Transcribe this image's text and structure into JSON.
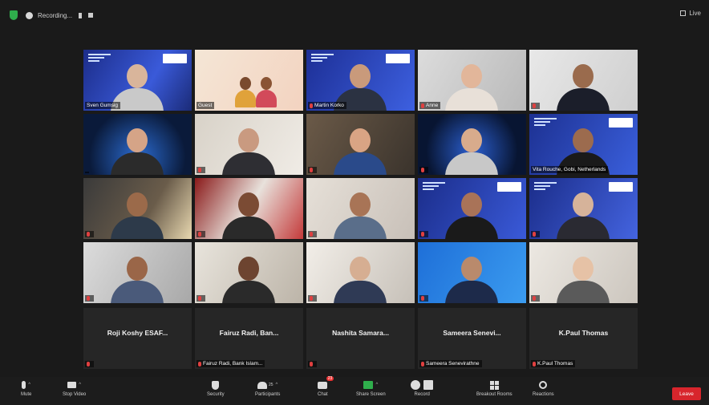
{
  "top_bar": {
    "recording_label": "Recording...",
    "view_label": "Live"
  },
  "colors": {
    "speaker_highlight": "#c9d43a",
    "leave": "#d8252c",
    "share_green": "#2fae4c",
    "muted_red": "#e04040"
  },
  "tiles": [
    {
      "name": "Sven Gumsig",
      "muted": false
    },
    {
      "name": "Guest",
      "muted": false
    },
    {
      "name": "Martin Korko",
      "muted": true
    },
    {
      "name": "Anne",
      "muted": true
    },
    {
      "name": "",
      "muted": true
    },
    {
      "name": "",
      "muted": false
    },
    {
      "name": "",
      "muted": true
    },
    {
      "name": "",
      "muted": true
    },
    {
      "name": "",
      "muted": true
    },
    {
      "name": "Vita Rouche, Gobi, Netherlands",
      "muted": false
    },
    {
      "name": "",
      "muted": true
    },
    {
      "name": "",
      "muted": true
    },
    {
      "name": "",
      "muted": true
    },
    {
      "name": "",
      "muted": true
    },
    {
      "name": "",
      "muted": true
    },
    {
      "name": "",
      "muted": true
    },
    {
      "name": "",
      "muted": true
    },
    {
      "name": "",
      "muted": true
    },
    {
      "name": "",
      "muted": true
    },
    {
      "name": "",
      "muted": true
    }
  ],
  "audio_only_tiles": [
    {
      "display": "Roji Koshy ESAF...",
      "label": "",
      "muted": true
    },
    {
      "display": "Fairuz Radi, Ban...",
      "label": "Fairuz Radi, Bank Islam...",
      "muted": true
    },
    {
      "display": "Nashita Samara...",
      "label": "",
      "muted": true
    },
    {
      "display": "Sameera Senevi...",
      "label": "Sameera Senevirathne",
      "muted": true
    },
    {
      "display": "K.Paul Thomas",
      "label": "K.Paul Thomas",
      "muted": true
    }
  ],
  "toolbar": {
    "mute": "Mute",
    "stop_video": "Stop Video",
    "security": "Security",
    "participants": "Participants",
    "participants_count": "25",
    "chat": "Chat",
    "chat_badge": "23",
    "share_screen": "Share Screen",
    "record": "Record",
    "breakout": "Breakout Rooms",
    "reactions": "Reactions",
    "leave": "Leave"
  }
}
